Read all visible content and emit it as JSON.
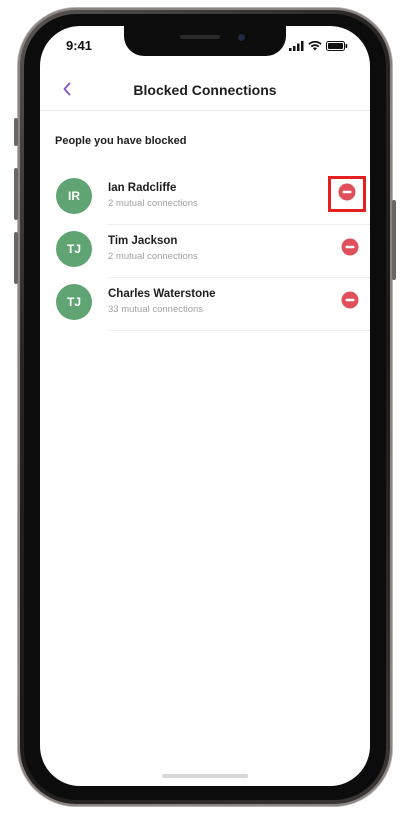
{
  "status_bar": {
    "time": "9:41",
    "signal_icon": "signal-icon",
    "wifi_icon": "wifi-icon",
    "battery_icon": "battery-icon"
  },
  "nav": {
    "back_icon": "chevron-left-icon",
    "title": "Blocked Connections"
  },
  "section": {
    "title": "People you have blocked"
  },
  "blocked": [
    {
      "initials": "IR",
      "name": "Ian Radcliffe",
      "subtitle": "2 mutual connections",
      "highlighted": true
    },
    {
      "initials": "TJ",
      "name": "Tim Jackson",
      "subtitle": "2 mutual connections",
      "highlighted": false
    },
    {
      "initials": "TJ",
      "name": "Charles Waterstone",
      "subtitle": "33 mutual connections",
      "highlighted": false
    }
  ],
  "colors": {
    "accent": "#8a5cc9",
    "avatar": "#5fa472",
    "unblock": "#e0505a",
    "highlight_box": "#e51f1f"
  },
  "icons": {
    "unblock": "minus-circle-icon"
  }
}
